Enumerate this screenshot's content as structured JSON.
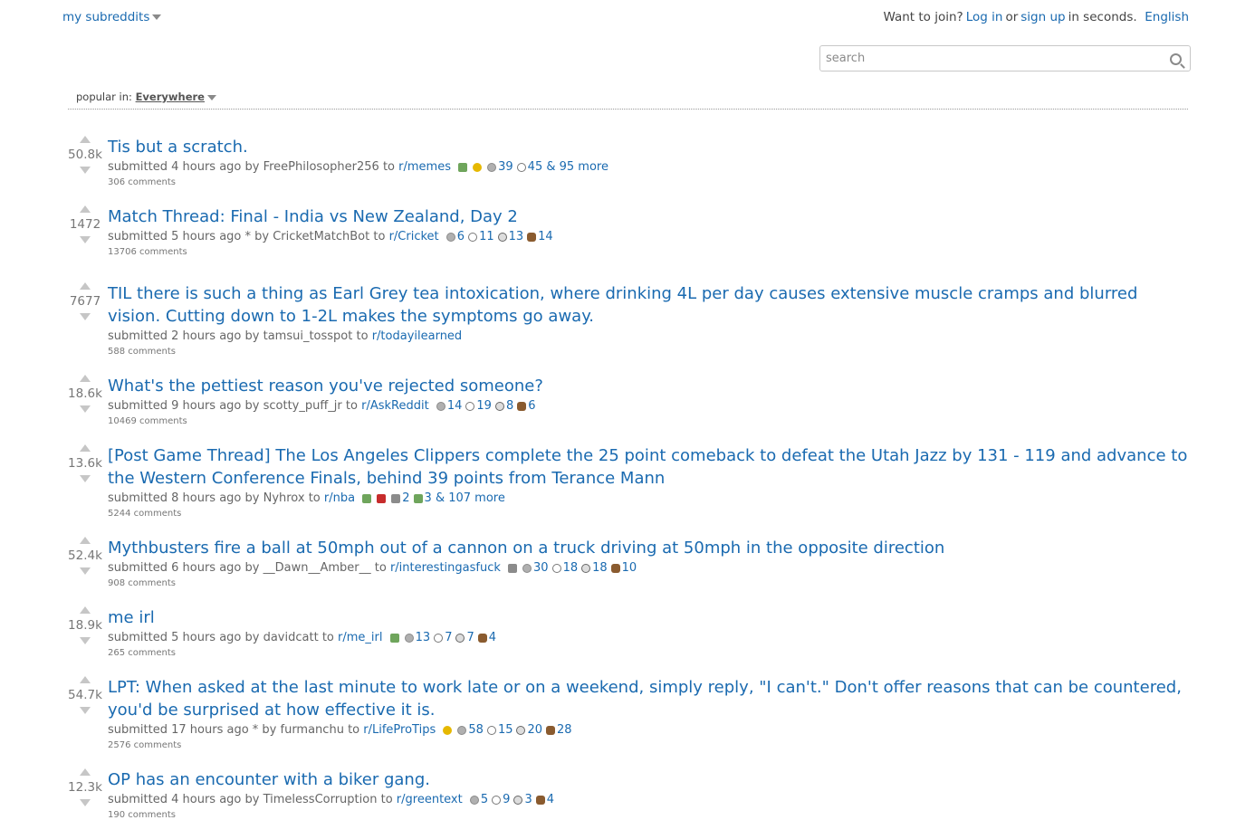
{
  "header": {
    "my_subreddits": "my subreddits",
    "want_to_join": "Want to join?",
    "log_in": "Log in",
    "or": "or",
    "sign_up": "sign up",
    "in_seconds": "in seconds.",
    "language": "English"
  },
  "search": {
    "placeholder": "search"
  },
  "popular": {
    "label": "popular in:",
    "location": "Everywhere"
  },
  "posts": [
    {
      "score": "50.8k",
      "title": "Tis but a scratch.",
      "submitted": "submitted 4 hours ago by",
      "author": "FreePhilosopher256",
      "to": "to",
      "subreddit": "r/memes",
      "awards": "39",
      "awards2": "45",
      "more": "& 95 more",
      "comments": "306 comments"
    },
    {
      "score": "1472",
      "title": "Match Thread: Final - India vs New Zealand, Day 2",
      "submitted": "submitted 5 hours ago * by",
      "author": "CricketMatchBot",
      "to": "to",
      "subreddit": "r/Cricket",
      "awards": "6",
      "awards2": "11",
      "awards3": "13",
      "awards4": "14",
      "comments": "13706 comments"
    },
    {
      "score": "7677",
      "title": "TIL there is such a thing as Earl Grey tea intoxication, where drinking 4L per day causes extensive muscle cramps and blurred vision. Cutting down to 1-2L makes the symptoms go away.",
      "submitted": "submitted 2 hours ago by",
      "author": "tamsui_tosspot",
      "to": "to",
      "subreddit": "r/todayilearned",
      "comments": "588 comments"
    },
    {
      "score": "18.6k",
      "title": "What's the pettiest reason you've rejected someone?",
      "submitted": "submitted 9 hours ago by",
      "author": "scotty_puff_jr",
      "to": "to",
      "subreddit": "r/AskReddit",
      "awards": "14",
      "awards2": "19",
      "awards3": "8",
      "awards4": "6",
      "comments": "10469 comments"
    },
    {
      "score": "13.6k",
      "title": "[Post Game Thread] The Los Angeles Clippers complete the 25 point comeback to defeat the Utah Jazz by 131 - 119 and advance to the Western Conference Finals, behind 39 points from Terance Mann",
      "submitted": "submitted 8 hours ago by",
      "author": "Nyhrox",
      "to": "to",
      "subreddit": "r/nba",
      "awards": "2",
      "awards2": "3",
      "more": "& 107 more",
      "comments": "5244 comments"
    },
    {
      "score": "52.4k",
      "title": "Mythbusters fire a ball at 50mph out of a cannon on a truck driving at 50mph in the opposite direction",
      "submitted": "submitted 6 hours ago by",
      "author": "__Dawn__Amber__",
      "to": "to",
      "subreddit": "r/interestingasfuck",
      "awards": "30",
      "awards2": "18",
      "awards3": "18",
      "awards4": "10",
      "comments": "908 comments"
    },
    {
      "score": "18.9k",
      "title": "me irl",
      "submitted": "submitted 5 hours ago by",
      "author": "davidcatt",
      "to": "to",
      "subreddit": "r/me_irl",
      "awards": "13",
      "awards2": "7",
      "awards3": "7",
      "awards4": "4",
      "comments": "265 comments"
    },
    {
      "score": "54.7k",
      "title": "LPT: When asked at the last minute to work late or on a weekend, simply reply, \"I can't.\" Don't offer reasons that can be countered, you'd be surprised at how effective it is.",
      "submitted": "submitted 17 hours ago * by",
      "author": "furmanchu",
      "to": "to",
      "subreddit": "r/LifeProTips",
      "awards": "58",
      "awards2": "15",
      "awards3": "20",
      "awards4": "28",
      "comments": "2576 comments"
    },
    {
      "score": "12.3k",
      "title": "OP has an encounter with a biker gang.",
      "submitted": "submitted 4 hours ago by",
      "author": "TimelessCorruption",
      "to": "to",
      "subreddit": "r/greentext",
      "awards": "5",
      "awards2": "9",
      "awards3": "3",
      "awards4": "4",
      "comments": "190 comments"
    }
  ]
}
